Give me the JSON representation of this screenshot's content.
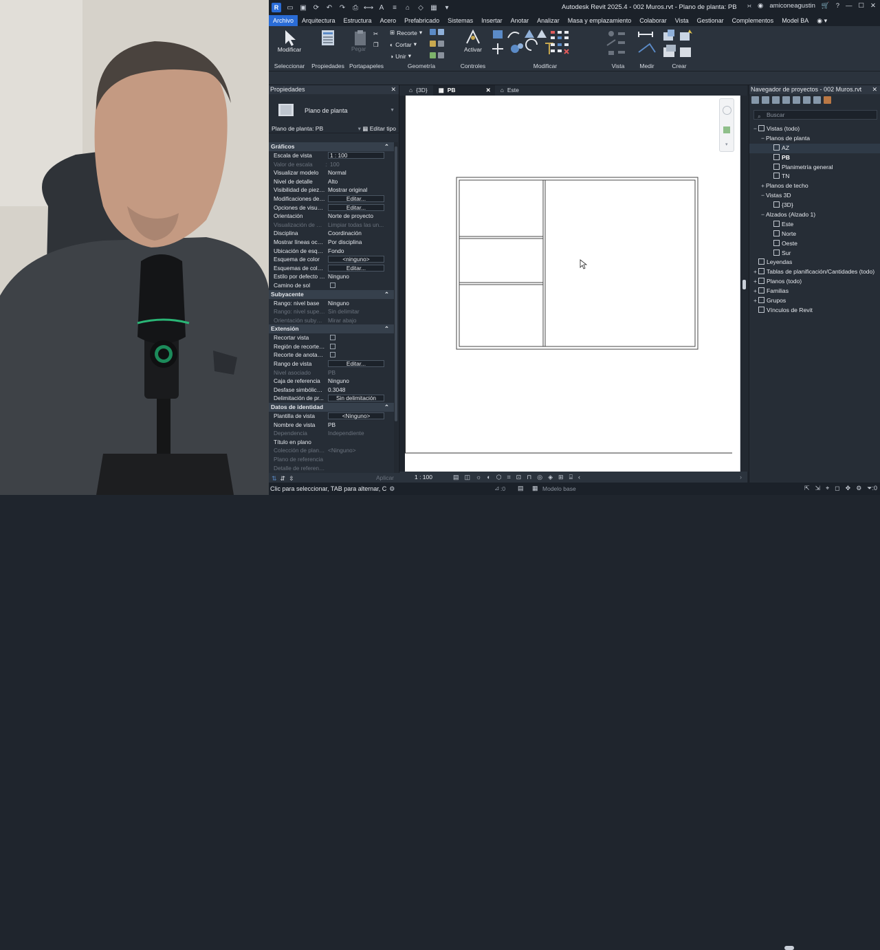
{
  "app": {
    "title": "Autodesk Revit 2025.4 - 002 Muros.rvt - Plano de planta: PB",
    "user": "amiconeagustin",
    "logo": "R"
  },
  "menu": [
    "Archivo",
    "Arquitectura",
    "Estructura",
    "Acero",
    "Prefabricado",
    "Sistemas",
    "Insertar",
    "Anotar",
    "Analizar",
    "Masa y emplazamiento",
    "Colaborar",
    "Vista",
    "Gestionar",
    "Complementos",
    "Model BA"
  ],
  "ribbon": {
    "modificar": "Modificar",
    "pegar": "Pegar",
    "recorte": "Recorte",
    "cortar": "Cortar",
    "unir": "Unir",
    "activar": "Activar",
    "panels": {
      "seleccionar": "Seleccionar",
      "propiedades": "Propiedades",
      "portapapeles": "Portapapeles",
      "geometria": "Geometría",
      "controles": "Controles",
      "modificar": "Modificar",
      "vista": "Vista",
      "medir": "Medir",
      "crear": "Crear"
    }
  },
  "properties": {
    "header": "Propiedades",
    "type_name": "Plano de planta",
    "selector": "Plano de planta: PB",
    "edit_type": "Editar tipo",
    "apply": "Aplicar",
    "categories": {
      "graficos": "Gráficos",
      "subyacente": "Subyacente",
      "extension": "Extensión",
      "identidad": "Datos de identidad"
    },
    "graficos_rows": [
      {
        "k": "Escala de vista",
        "v": "1 : 100",
        "kind": "input"
      },
      {
        "k": "Valor de escala",
        "v": "100",
        "kind": "dis",
        "k2": "1:"
      },
      {
        "k": "Visualizar modelo",
        "v": "Normal",
        "kind": "text"
      },
      {
        "k": "Nivel de detalle",
        "v": "Alto",
        "kind": "text"
      },
      {
        "k": "Visibilidad de piezas",
        "v": "Mostrar original",
        "kind": "text"
      },
      {
        "k": "Modificaciones de ...",
        "v": "Editar...",
        "kind": "btn"
      },
      {
        "k": "Opciones de visuali...",
        "v": "Editar...",
        "kind": "btn"
      },
      {
        "k": "Orientación",
        "v": "Norte de proyecto",
        "kind": "text"
      },
      {
        "k": "Visualización de un...",
        "v": "Limpiar todas las un...",
        "kind": "dis"
      },
      {
        "k": "Disciplina",
        "v": "Coordinación",
        "kind": "text"
      },
      {
        "k": "Mostrar líneas ocul...",
        "v": "Por disciplina",
        "kind": "text"
      },
      {
        "k": "Ubicación de esqu...",
        "v": "Fondo",
        "kind": "text"
      },
      {
        "k": "Esquema de color",
        "v": "<ninguno>",
        "kind": "btn"
      },
      {
        "k": "Esquemas de color ...",
        "v": "Editar...",
        "kind": "btn"
      },
      {
        "k": "Estilo por defecto d...",
        "v": "Ninguno",
        "kind": "text"
      },
      {
        "k": "Camino de sol",
        "v": "",
        "kind": "check"
      }
    ],
    "subyacente_rows": [
      {
        "k": "Rango: nivel base",
        "v": "Ninguno",
        "kind": "text"
      },
      {
        "k": "Rango: nivel superior",
        "v": "Sin delimitar",
        "kind": "dis"
      },
      {
        "k": "Orientación subyac...",
        "v": "Mirar abajo",
        "kind": "dis"
      }
    ],
    "extension_rows": [
      {
        "k": "Recortar vista",
        "v": "",
        "kind": "check"
      },
      {
        "k": "Región de recorte v...",
        "v": "",
        "kind": "check"
      },
      {
        "k": "Recorte de anotación",
        "v": "",
        "kind": "check"
      },
      {
        "k": "Rango de vista",
        "v": "Editar...",
        "kind": "btn"
      },
      {
        "k": "Nivel asociado",
        "v": "PB",
        "kind": "dis"
      },
      {
        "k": "Caja de referencia",
        "v": "Ninguno",
        "kind": "text"
      },
      {
        "k": "Desfase simbólico ...",
        "v": "0.3048",
        "kind": "text"
      },
      {
        "k": "Delimitación de pr...",
        "v": "Sin delimitación",
        "kind": "btn"
      }
    ],
    "identidad_rows": [
      {
        "k": "Plantilla de vista",
        "v": "<Ninguno>",
        "kind": "btn"
      },
      {
        "k": "Nombre de vista",
        "v": "PB",
        "kind": "text"
      },
      {
        "k": "Dependencia",
        "v": "Independiente",
        "kind": "dis"
      },
      {
        "k": "Título en plano",
        "v": "",
        "kind": "text"
      },
      {
        "k": "Colección de plano...",
        "v": "<Ninguno>",
        "kind": "dis"
      },
      {
        "k": "Plano de referencia",
        "v": "",
        "kind": "dis"
      },
      {
        "k": "Detalle de referencia",
        "v": "",
        "kind": "dis"
      }
    ]
  },
  "tabs": [
    {
      "label": "{3D}",
      "active": false
    },
    {
      "label": "PB",
      "active": true
    },
    {
      "label": "Este",
      "active": false
    }
  ],
  "viewbar": {
    "scale": "1 : 100"
  },
  "browser": {
    "header": "Navegador de proyectos - 002 Muros.rvt",
    "search_placeholder": "Buscar",
    "tree": [
      {
        "label": "Vistas (todo)",
        "level": 0,
        "exp": "−",
        "icon": true
      },
      {
        "label": "Planos de planta",
        "level": 1,
        "exp": "−"
      },
      {
        "label": "AZ",
        "level": 2,
        "exp": "",
        "icon": true,
        "sel": true
      },
      {
        "label": "PB",
        "level": 2,
        "exp": "",
        "icon": true,
        "bold": true
      },
      {
        "label": "Planimetría general",
        "level": 2,
        "exp": "",
        "icon": true
      },
      {
        "label": "TN",
        "level": 2,
        "exp": "",
        "icon": true
      },
      {
        "label": "Planos de techo",
        "level": 1,
        "exp": "+"
      },
      {
        "label": "Vistas 3D",
        "level": 1,
        "exp": "−"
      },
      {
        "label": "{3D}",
        "level": 2,
        "exp": "",
        "icon": true
      },
      {
        "label": "Alzados (Alzado 1)",
        "level": 1,
        "exp": "−"
      },
      {
        "label": "Este",
        "level": 2,
        "exp": "",
        "icon": true
      },
      {
        "label": "Norte",
        "level": 2,
        "exp": "",
        "icon": true
      },
      {
        "label": "Oeste",
        "level": 2,
        "exp": "",
        "icon": true
      },
      {
        "label": "Sur",
        "level": 2,
        "exp": "",
        "icon": true
      },
      {
        "label": "Leyendas",
        "level": 0,
        "exp": "",
        "icon": true
      },
      {
        "label": "Tablas de planificación/Cantidades (todo)",
        "level": 0,
        "exp": "+",
        "icon": true
      },
      {
        "label": "Planos (todo)",
        "level": 0,
        "exp": "+",
        "icon": true
      },
      {
        "label": "Familias",
        "level": 0,
        "exp": "+",
        "icon": true
      },
      {
        "label": "Grupos",
        "level": 0,
        "exp": "+",
        "icon": true
      },
      {
        "label": "Vínculos de Revit",
        "level": 0,
        "exp": "",
        "icon": true
      }
    ]
  },
  "status": {
    "message": "Clic para seleccionar, TAB para alternar, C",
    "model": "Modelo base",
    "coord_a": ":0",
    "filter": ":0"
  },
  "colors": {
    "accent": "#2a6cd6",
    "panel": "#262d36",
    "ribbon": "#2b333d"
  }
}
